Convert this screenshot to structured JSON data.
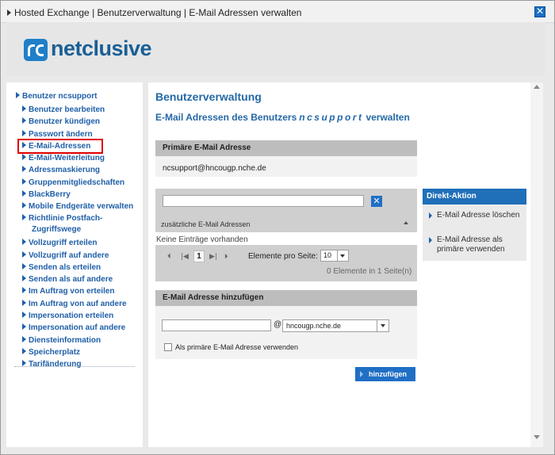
{
  "window": {
    "title": "Hosted Exchange | Benutzerverwaltung | E-Mail Adressen verwalten",
    "close_glyph": "✕"
  },
  "logo": {
    "text": "netclusive"
  },
  "sidebar": {
    "root": "Benutzer ncsupport",
    "items": [
      {
        "label": "Benutzer bearbeiten"
      },
      {
        "label": "Benutzer kündigen"
      },
      {
        "label": "Passwort ändern"
      },
      {
        "label": "E-Mail-Adressen",
        "active": true
      },
      {
        "label": "E-Mail-Weiterleitung"
      },
      {
        "label": "Adressmaskierung"
      },
      {
        "label": "Gruppenmitgliedschaften"
      },
      {
        "label": "BlackBerry"
      },
      {
        "label": "Mobile Endgeräte verwalten"
      },
      {
        "label": "Richtlinie Postfach-",
        "label2": "Zugriffswege"
      },
      {
        "label": "Vollzugriff erteilen"
      },
      {
        "label": "Vollzugriff auf andere"
      },
      {
        "label": "Senden als erteilen"
      },
      {
        "label": "Senden als auf andere"
      },
      {
        "label": "Im Auftrag von erteilen"
      },
      {
        "label": "Im Auftrag von auf andere"
      },
      {
        "label": "Impersonation erteilen"
      },
      {
        "label": "Impersonation auf andere"
      },
      {
        "label": "Diensteinformation"
      },
      {
        "label": "Speicherplatz"
      },
      {
        "label": "Tarifänderung"
      }
    ]
  },
  "main": {
    "title": "Benutzerverwaltung",
    "subtitle_prefix": "E-Mail Adressen des Benutzers",
    "subtitle_user": "ncsupport",
    "subtitle_suffix": "verwalten",
    "primary": {
      "header": "Primäre E-Mail Adresse",
      "value": "ncsupport@hncougp.nche.de"
    },
    "list": {
      "filter_value": "",
      "clear_glyph": "✕",
      "label": "zusätzliche E-Mail Adressen",
      "empty_text": "Keine Einträge vorhanden"
    },
    "pager": {
      "first": "⏴",
      "prev_page": "|◀",
      "current_page": "1",
      "next_page": "▶|",
      "last": "⏵",
      "per_page_label": "Elemente pro Seite:",
      "per_page_value": "10",
      "total_text": "0 Elemente in 1 Seite(n)"
    },
    "add": {
      "header": "E-Mail Adresse hinzufügen",
      "local_value": "",
      "at": "@",
      "domain": "hncougp.nche.de",
      "checkbox_label": "Als primäre E-Mail Adresse verwenden",
      "checkbox_checked": false,
      "button_label": "hinzufügen"
    }
  },
  "direct_action": {
    "header": "Direkt-Aktion",
    "items": [
      {
        "label": "E-Mail Adresse löschen"
      },
      {
        "label": "E-Mail Adresse als primäre verwenden"
      }
    ]
  },
  "colors": {
    "accent": "#1f6fc5",
    "link": "#1f5fa8",
    "active_outline": "#e00000"
  }
}
